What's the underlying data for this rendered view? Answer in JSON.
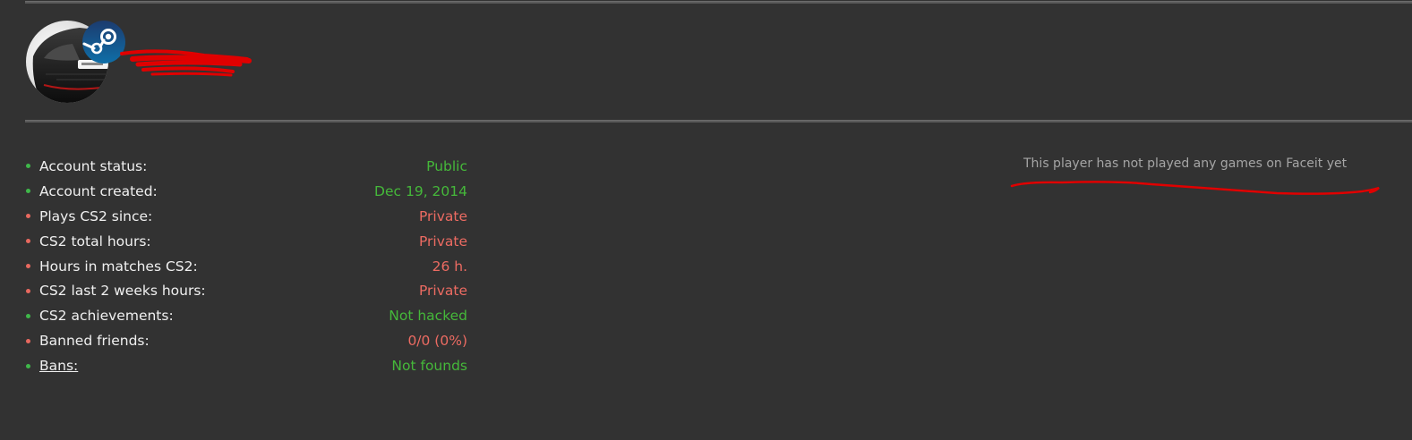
{
  "profile": {
    "avatar_icon": "user-avatar-car",
    "platform_icon": "steam-icon",
    "name_redacted": true
  },
  "stats": [
    {
      "label": "Account status:",
      "value": "Public",
      "status": "good",
      "link": false
    },
    {
      "label": "Account created:",
      "value": "Dec 19, 2014",
      "status": "good",
      "link": false
    },
    {
      "label": "Plays CS2 since:",
      "value": "Private",
      "status": "bad",
      "link": false
    },
    {
      "label": "CS2 total hours:",
      "value": "Private",
      "status": "bad",
      "link": false
    },
    {
      "label": "Hours in matches CS2:",
      "value": "26 h.",
      "status": "bad",
      "link": false
    },
    {
      "label": "CS2 last 2 weeks hours:",
      "value": "Private",
      "status": "bad",
      "link": false
    },
    {
      "label": "CS2 achievements:",
      "value": "Not hacked",
      "status": "good",
      "link": false
    },
    {
      "label": "Banned friends:",
      "value": "0/0 (0%)",
      "status": "bad",
      "link": false
    },
    {
      "label": "Bans:",
      "value": "Not founds",
      "status": "good",
      "link": true
    }
  ],
  "faceit": {
    "message": "This player has not played any games on Faceit yet"
  },
  "colors": {
    "background": "#323232",
    "good": "#45b83a",
    "bad": "#ec6b62",
    "label": "#f0f0f0",
    "muted": "#a5a5a5",
    "redaction": "#e00000"
  }
}
